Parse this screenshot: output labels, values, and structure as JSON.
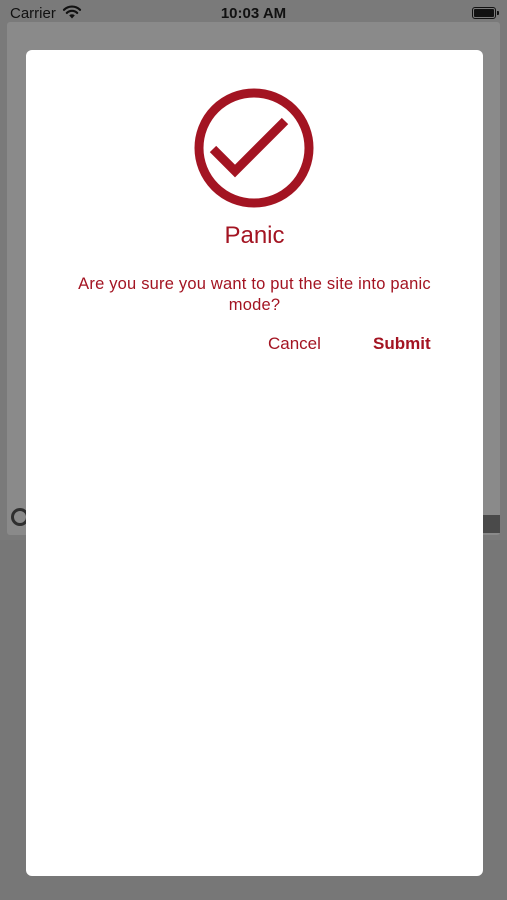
{
  "status_bar": {
    "carrier": "Carrier",
    "time": "10:03 AM"
  },
  "dialog": {
    "icon": "check-circle-icon",
    "title": "Panic",
    "message": "Are you sure you want to put the site into panic mode?",
    "cancel_label": "Cancel",
    "submit_label": "Submit"
  },
  "colors": {
    "accent": "#a31422",
    "overlay": "#7a7a7a",
    "dialog_background": "#ffffff"
  }
}
